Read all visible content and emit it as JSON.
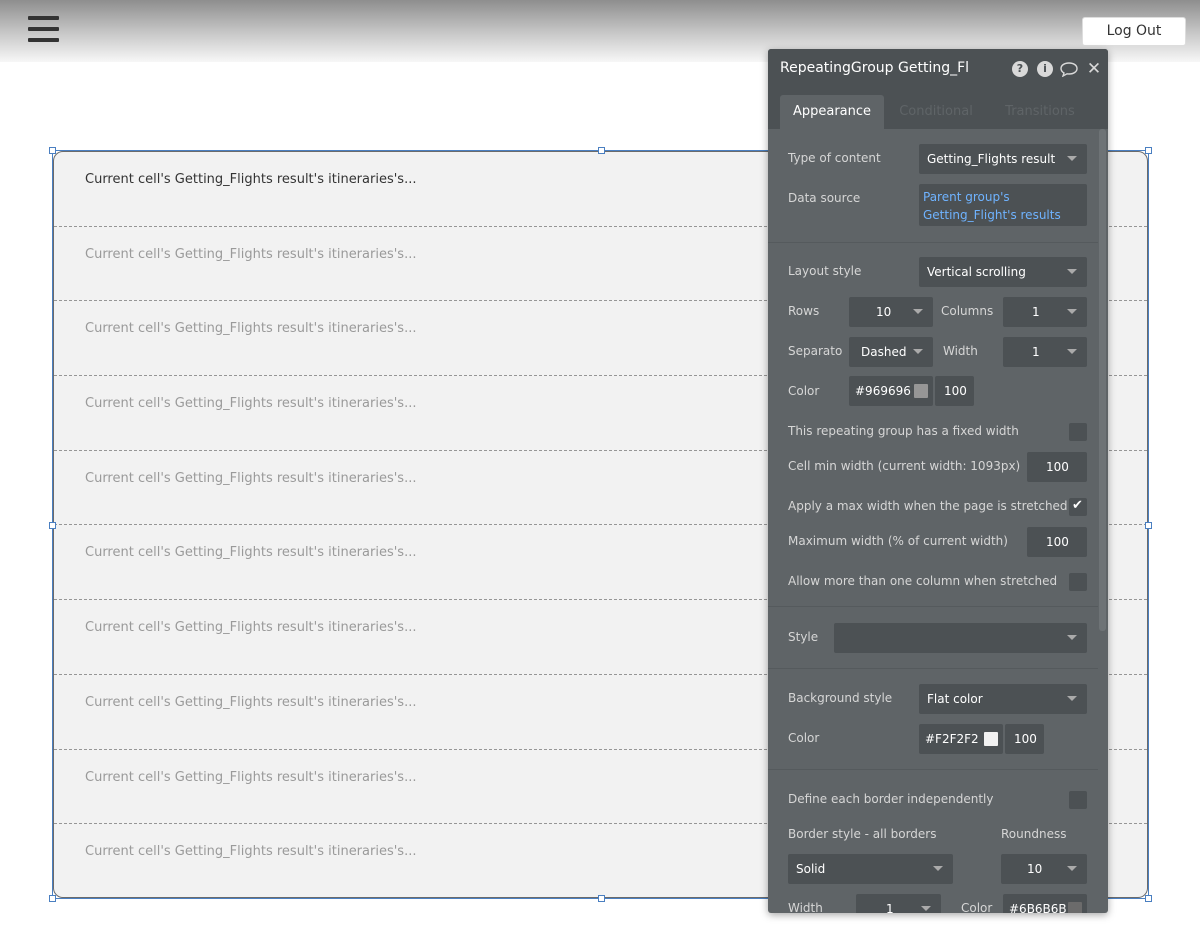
{
  "topbar": {
    "logout_label": "Log Out"
  },
  "repeating_group": {
    "cells": [
      "Current cell's Getting_Flights result's itineraries's...",
      "Current cell's Getting_Flights result's itineraries's...",
      "Current cell's Getting_Flights result's itineraries's...",
      "Current cell's Getting_Flights result's itineraries's...",
      "Current cell's Getting_Flights result's itineraries's...",
      "Current cell's Getting_Flights result's itineraries's...",
      "Current cell's Getting_Flights result's itineraries's...",
      "Current cell's Getting_Flights result's itineraries's...",
      "Current cell's Getting_Flights result's itineraries's...",
      "Current cell's Getting_Flights result's itineraries's..."
    ]
  },
  "panel": {
    "title": "RepeatingGroup Getting_Flights results",
    "tabs": {
      "appearance": "Appearance",
      "conditional": "Conditional",
      "transitions": "Transitions"
    },
    "type_of_content": {
      "label": "Type of content",
      "value": "Getting_Flights result"
    },
    "data_source": {
      "label": "Data source",
      "line1": "Parent group's",
      "line2": "Getting_Flight's results"
    },
    "layout_style": {
      "label": "Layout style",
      "value": "Vertical scrolling"
    },
    "rows": {
      "label": "Rows",
      "value": "10"
    },
    "columns": {
      "label": "Columns",
      "value": "1"
    },
    "separator": {
      "label": "Separato",
      "value": "Dashed"
    },
    "width": {
      "label": "Width",
      "value": "1"
    },
    "color": {
      "label": "Color",
      "hex": "#969696",
      "opacity": "100"
    },
    "fixed_width": {
      "label": "This repeating group has a fixed width",
      "checked": false
    },
    "cell_min_width": {
      "label": "Cell min width (current width: 1093px)",
      "value": "100"
    },
    "apply_max_width": {
      "label": "Apply a max width when the page is stretched",
      "checked": true
    },
    "max_width": {
      "label": "Maximum width (% of current width)",
      "value": "100"
    },
    "allow_columns": {
      "label": "Allow more than one column when stretched",
      "checked": false
    },
    "style": {
      "label": "Style",
      "value": ""
    },
    "background_style": {
      "label": "Background style",
      "value": "Flat color"
    },
    "bg_color": {
      "label": "Color",
      "hex": "#F2F2F2",
      "opacity": "100"
    },
    "border_independent": {
      "label": "Define each border independently",
      "checked": false
    },
    "border_style": {
      "label": "Border style - all borders",
      "value": "Solid"
    },
    "roundness": {
      "label": "Roundness",
      "value": "10"
    },
    "border_width": {
      "label": "Width",
      "value": "1"
    },
    "border_color": {
      "label": "Color",
      "hex": "#6B6B6B"
    }
  }
}
